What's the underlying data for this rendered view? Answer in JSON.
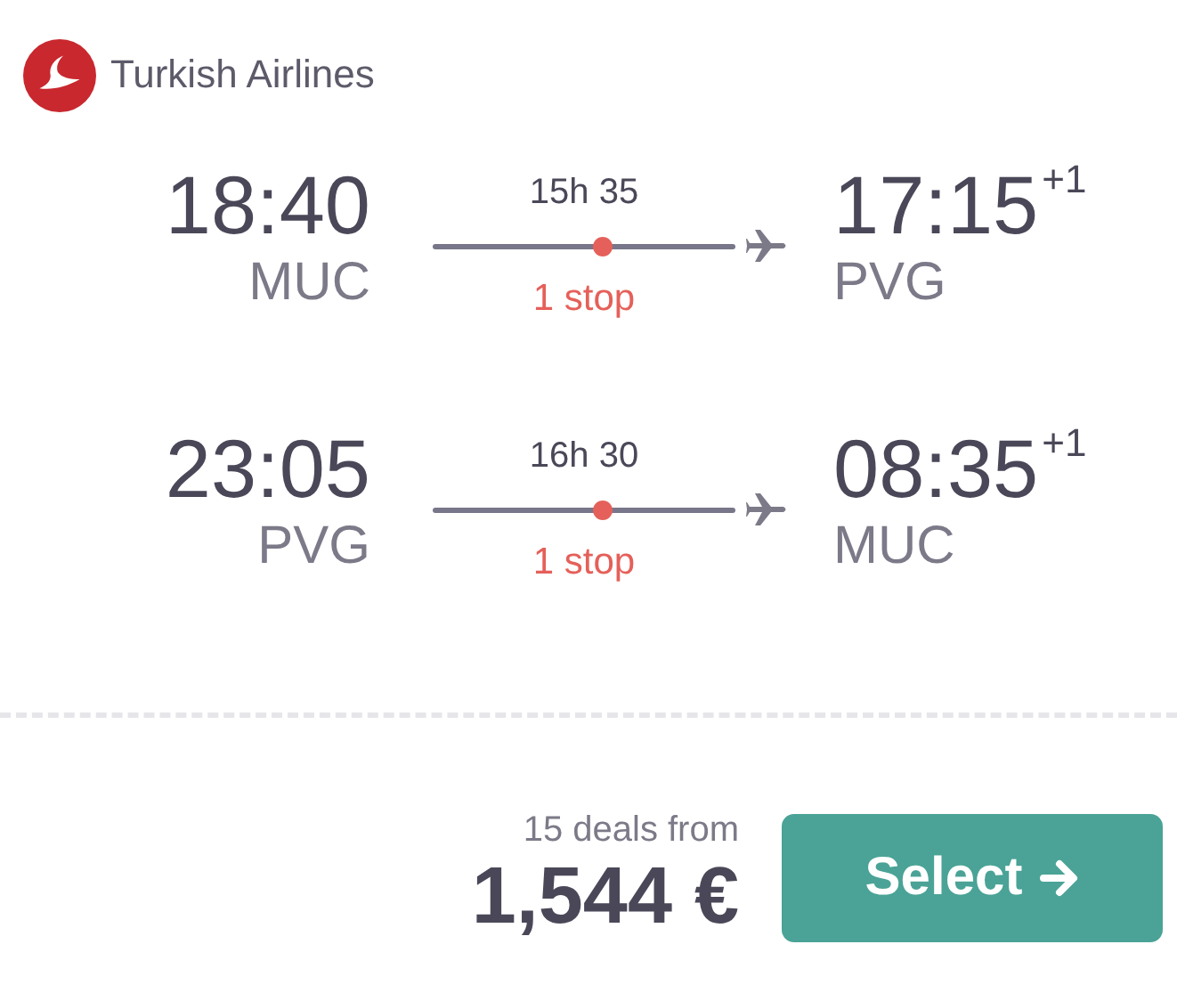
{
  "airline": {
    "name": "Turkish Airlines"
  },
  "legs": [
    {
      "departure_time": "18:40",
      "departure_airport": "MUC",
      "duration": "15h 35",
      "stops": "1 stop",
      "arrival_time": "17:15",
      "day_offset": "+1",
      "arrival_airport": "PVG"
    },
    {
      "departure_time": "23:05",
      "departure_airport": "PVG",
      "duration": "16h 30",
      "stops": "1 stop",
      "arrival_time": "08:35",
      "day_offset": "+1",
      "arrival_airport": "MUC"
    }
  ],
  "deals": {
    "count_label": "15 deals from",
    "price": "1,544 €"
  },
  "select_button": {
    "label": "Select"
  }
}
